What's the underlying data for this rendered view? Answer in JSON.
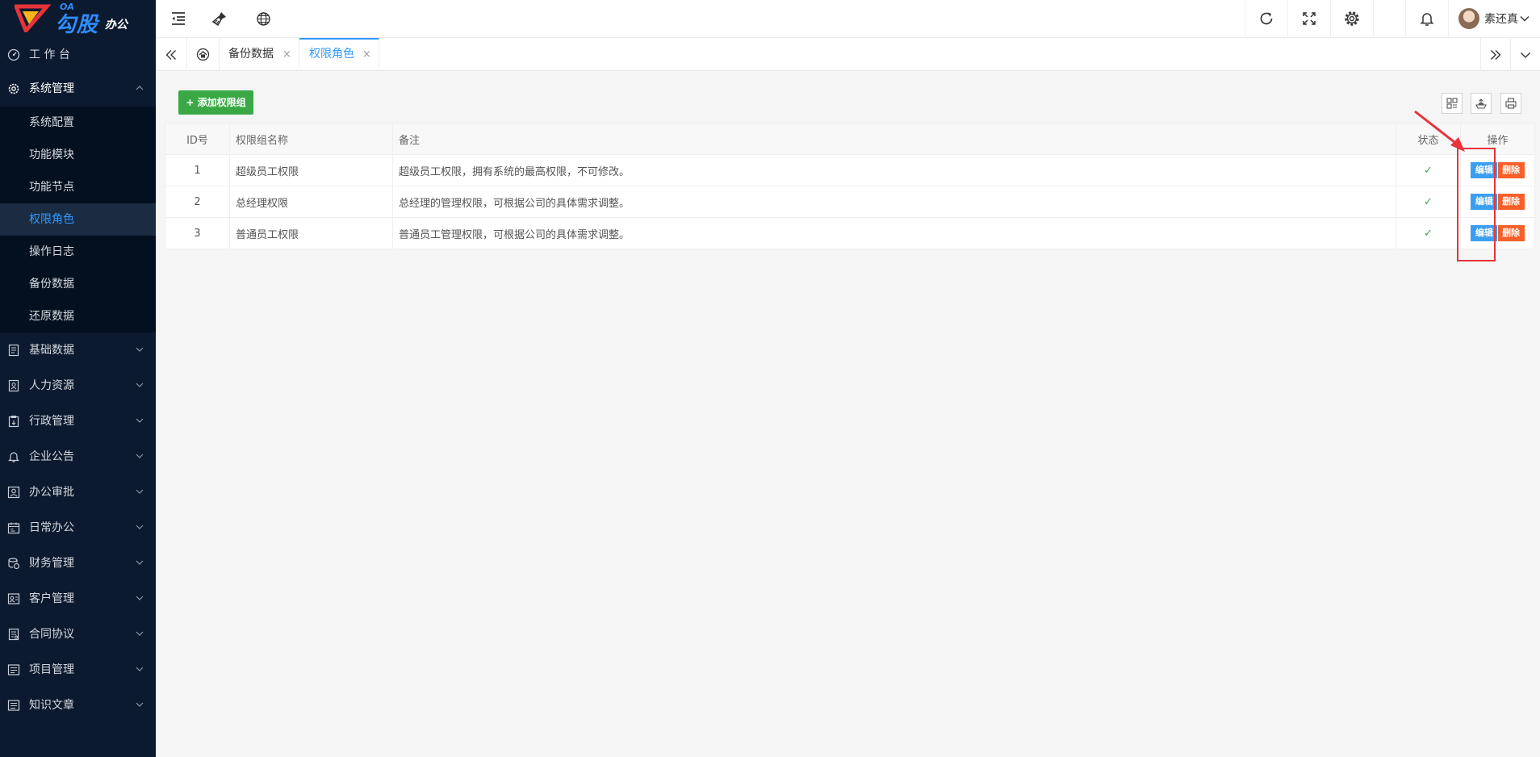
{
  "sidebar": {
    "logo": {
      "title": "勾股",
      "subtitle": "办公",
      "tag": "OA"
    },
    "workbench": "工 作 台",
    "system": {
      "label": "系统管理",
      "children": [
        "系统配置",
        "功能模块",
        "功能节点",
        "权限角色",
        "操作日志",
        "备份数据",
        "还原数据"
      ],
      "active_index": 3
    },
    "groups": [
      "基础数据",
      "人力资源",
      "行政管理",
      "企业公告",
      "办公审批",
      "日常办公",
      "财务管理",
      "客户管理",
      "合同协议",
      "项目管理",
      "知识文章"
    ]
  },
  "header": {
    "user_name": "素还真"
  },
  "tabs": {
    "items": [
      {
        "label": "备份数据",
        "close": "×"
      },
      {
        "label": "权限角色",
        "close": "×"
      }
    ],
    "active_index": 1
  },
  "toolbar": {
    "add_label": "+ 添加权限组"
  },
  "table": {
    "columns": [
      "ID号",
      "权限组名称",
      "备注",
      "状态",
      "操作"
    ],
    "rows": [
      {
        "id": "1",
        "name": "超级员工权限",
        "note": "超级员工权限，拥有系统的最高权限，不可修改。",
        "status": "✓"
      },
      {
        "id": "2",
        "name": "总经理权限",
        "note": "总经理的管理权限，可根据公司的具体需求调整。",
        "status": "✓"
      },
      {
        "id": "3",
        "name": "普通员工权限",
        "note": "普通员工管理权限，可根据公司的具体需求调整。",
        "status": "✓"
      }
    ],
    "edit_label": "编辑",
    "delete_label": "删除"
  },
  "colors": {
    "sidebar_bg": "#0b1a2f",
    "accent": "#2f9aff",
    "add_button": "#3aa945",
    "edit_button": "#3b9ff0",
    "delete_button": "#f7602a",
    "annotation": "#e8333a",
    "status_ok": "#3aa945"
  }
}
